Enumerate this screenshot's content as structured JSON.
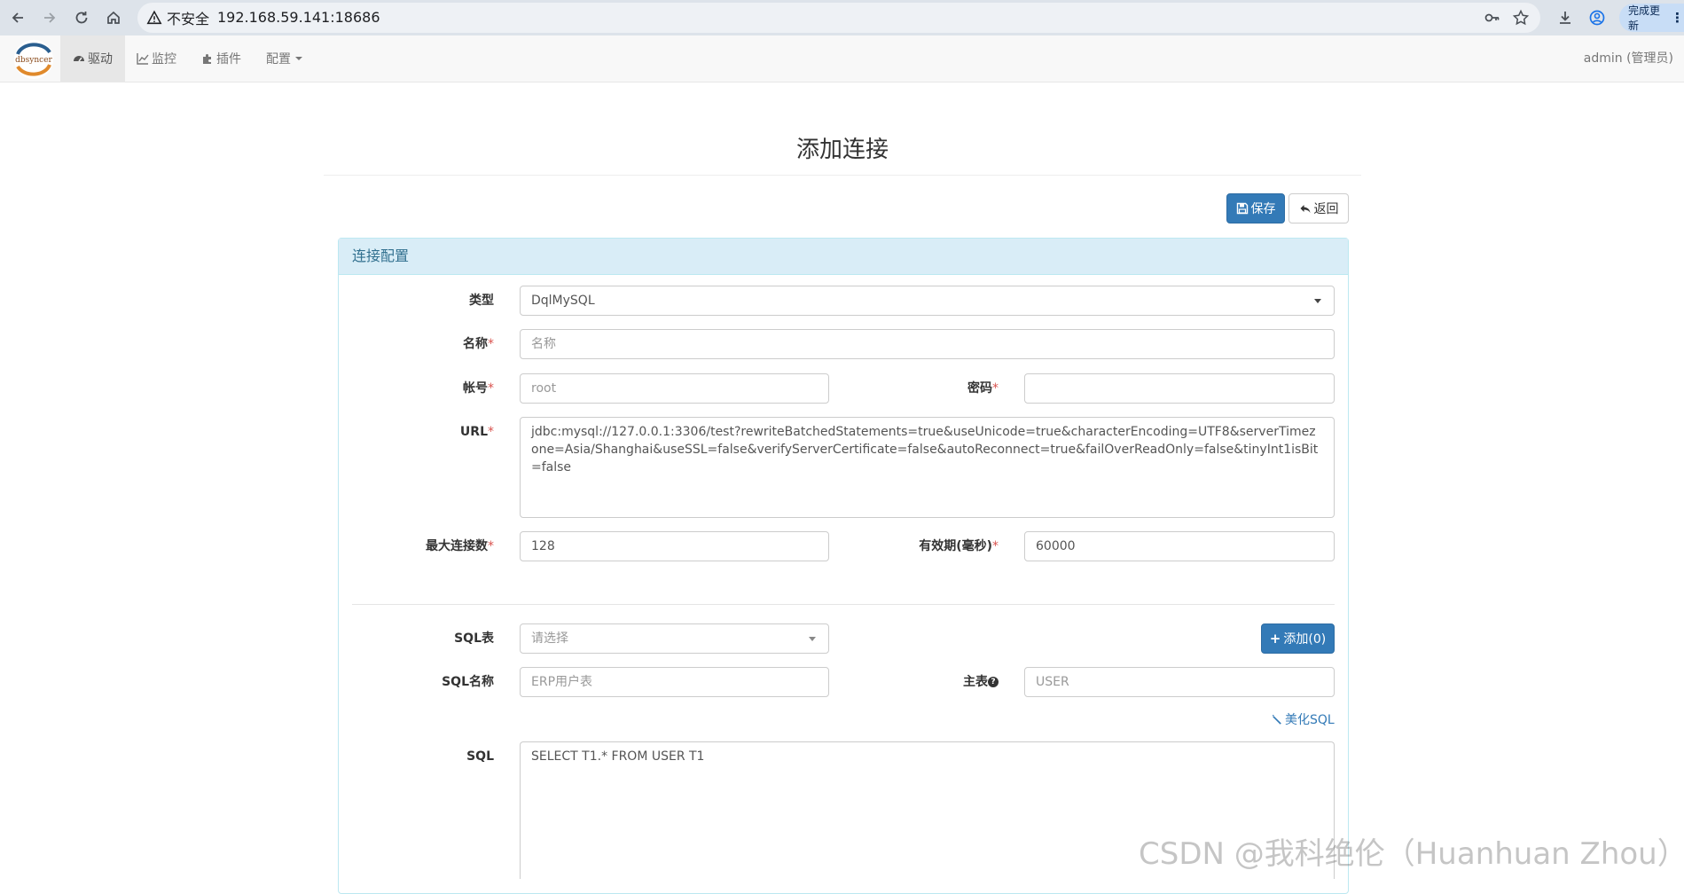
{
  "browser": {
    "security_label": "不安全",
    "url": "192.168.59.141:18686",
    "update_label": "完成更新"
  },
  "navbar": {
    "logo_text": "dbsyncer",
    "items": [
      {
        "label": "驱动",
        "icon": "dashboard-icon",
        "active": true
      },
      {
        "label": "监控",
        "icon": "line-chart-icon",
        "active": false
      },
      {
        "label": "插件",
        "icon": "puzzle-icon",
        "active": false
      },
      {
        "label": "配置",
        "icon": "dropdown-caret-icon",
        "active": false
      }
    ],
    "user": "admin (管理员)"
  },
  "page": {
    "title": "添加连接",
    "save_label": "保存",
    "back_label": "返回"
  },
  "panel": {
    "heading": "连接配置",
    "fields": {
      "type": {
        "label": "类型",
        "value": "DqlMySQL"
      },
      "name": {
        "label": "名称",
        "placeholder": "名称",
        "required": "*"
      },
      "account": {
        "label": "帐号",
        "placeholder": "root",
        "required": "*"
      },
      "password": {
        "label": "密码",
        "value": "",
        "required": "*"
      },
      "url": {
        "label": "URL",
        "required": "*",
        "value": "jdbc:mysql://127.0.0.1:3306/test?rewriteBatchedStatements=true&useUnicode=true&characterEncoding=UTF8&serverTimezone=Asia/Shanghai&useSSL=false&verifyServerCertificate=false&autoReconnect=true&failOverReadOnly=false&tinyInt1isBit=false"
      },
      "max_connections": {
        "label": "最大连接数",
        "value": "128",
        "required": "*"
      },
      "validity": {
        "label": "有效期(毫秒)",
        "value": "60000",
        "required": "*"
      },
      "sql_table": {
        "label": "SQL表",
        "placeholder": "请选择"
      },
      "add_button": "添加(0)",
      "sql_name": {
        "label": "SQL名称",
        "placeholder": "ERP用户表"
      },
      "main_table": {
        "label": "主表",
        "placeholder": "USER"
      },
      "beautify_label": "美化SQL",
      "sql": {
        "label": "SQL",
        "value": "SELECT T1.* FROM USER T1"
      }
    }
  },
  "watermark": "CSDN @我科绝伦（Huanhuan Zhou）"
}
